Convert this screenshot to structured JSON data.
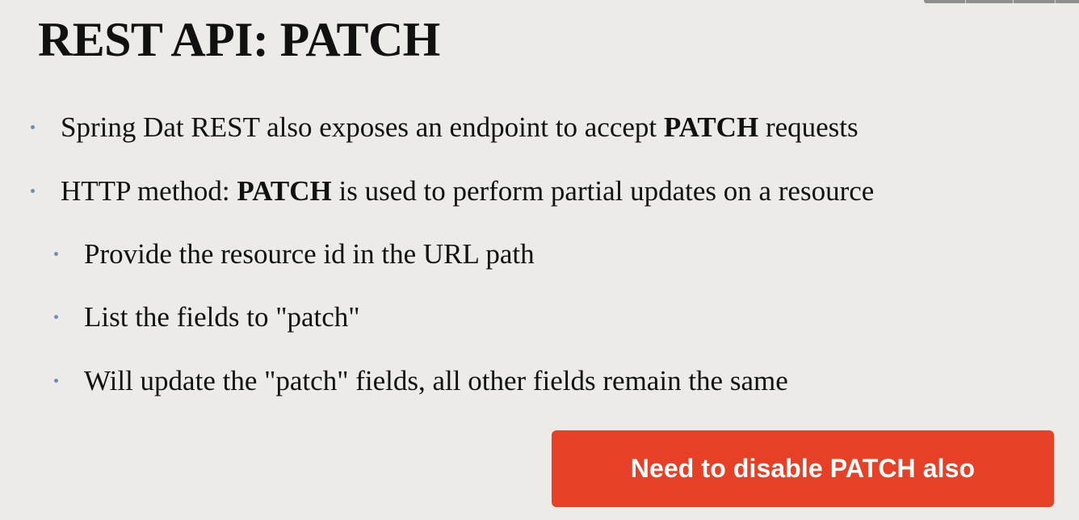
{
  "slide": {
    "title": "REST API: PATCH",
    "bullets": [
      {
        "before": "Spring Dat REST also exposes an endpoint to accept ",
        "bold": "PATCH",
        "after": " requests"
      },
      {
        "before": "HTTP method: ",
        "bold": "PATCH",
        "after": " is used to perform partial updates on a resource"
      },
      {
        "text": "Provide the resource id in the URL path"
      },
      {
        "text": "List the fields to \"patch\""
      },
      {
        "text": "Will update the \"patch\" fields, all other fields remain the same"
      }
    ],
    "callout": "Need to disable PATCH also"
  },
  "colors": {
    "background": "#ecebe7",
    "bullet_dot": "#6f90b5",
    "callout_fill": "#e64027",
    "callout_text": "#ffffff"
  }
}
